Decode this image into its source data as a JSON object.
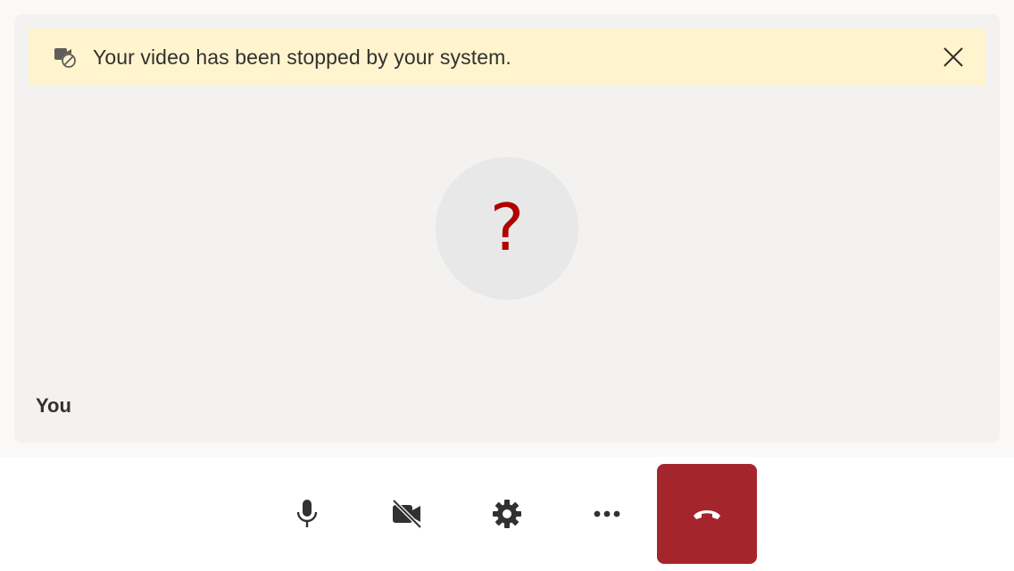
{
  "banner": {
    "message": "Your video has been stopped by your system.",
    "icon": "video-blocked-icon",
    "close_icon": "close-icon",
    "background": "#fff4ce"
  },
  "participant": {
    "name": "You",
    "avatar_glyph": "?",
    "avatar_glyph_color": "#b00000"
  },
  "controls": {
    "items": [
      {
        "icon": "microphone-icon"
      },
      {
        "icon": "camera-off-icon"
      },
      {
        "icon": "gear-icon"
      },
      {
        "icon": "more-icon"
      },
      {
        "icon": "hang-up-icon",
        "color": "#a4262c"
      }
    ]
  }
}
